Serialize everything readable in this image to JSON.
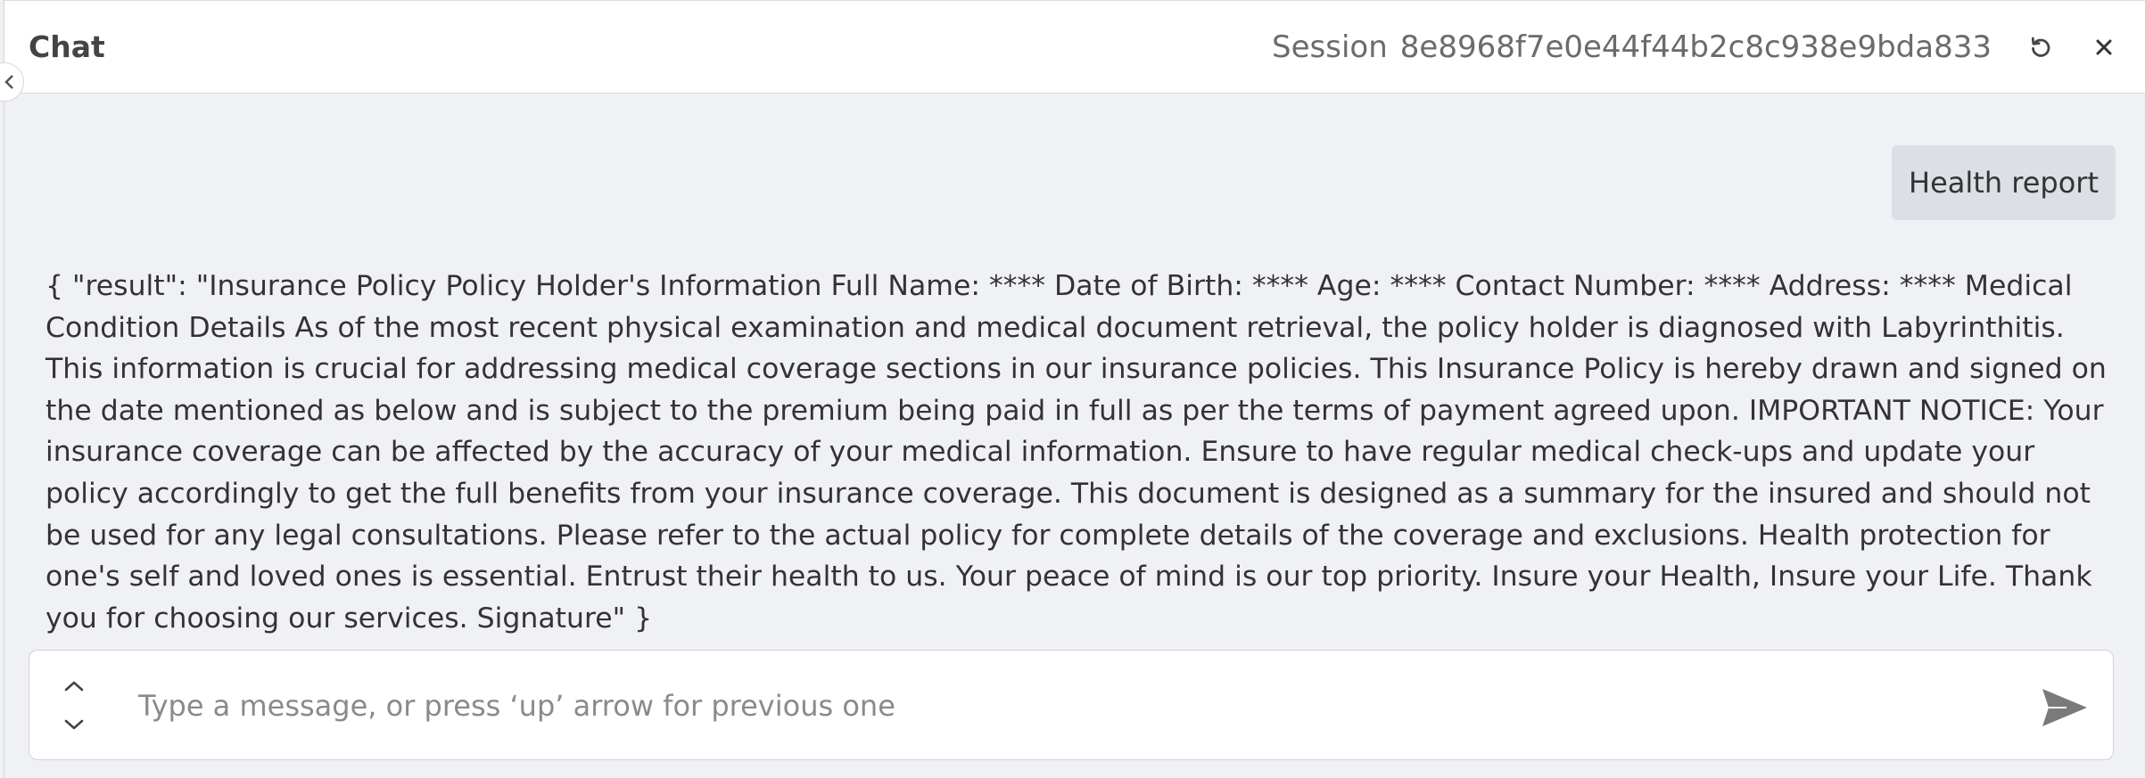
{
  "header": {
    "title": "Chat",
    "session_label": "Session",
    "session_id": "8e8968f7e0e44f44b2c8c938e9bda833"
  },
  "icons": {
    "reset": "reset-icon",
    "close": "close-icon",
    "collapse": "chevron-left-icon",
    "history_up": "chevron-up-icon",
    "history_down": "chevron-down-icon",
    "send": "send-icon"
  },
  "messages": {
    "user": "Health report",
    "assistant": "{ \"result\": \"Insurance Policy Policy Holder's Information Full Name: **** Date of Birth: **** Age: **** Contact Number: **** Address: **** Medical Condition Details As of the most recent physical examination and medical document retrieval, the policy holder is diagnosed with Labyrinthitis. This information is crucial for addressing medical coverage sections in our insurance policies. This Insurance Policy is hereby drawn and signed on the date mentioned as below and is subject to the premium being paid in full as per the terms of payment agreed upon. IMPORTANT NOTICE: Your insurance coverage can be affected by the accuracy of your medical information. Ensure to have regular medical check-ups and update your policy accordingly to get the full benefits from your insurance coverage. This document is designed as a summary for the insured and should not be used for any legal consultations. Please refer to the actual policy for complete details of the coverage and exclusions. Health protection for one's self and loved ones is essential. Entrust their health to us. Your peace of mind is our top priority. Insure your Health, Insure your Life. Thank you for choosing our services. Signature\" }"
  },
  "composer": {
    "value": "",
    "placeholder": "Type a message, or press ‘up’ arrow for previous one"
  },
  "colors": {
    "panel_bg": "#f0f1f4",
    "header_bg": "#ffffff",
    "user_bubble": "#dcdfe6",
    "text": "#333333",
    "muted": "#6b6b6b",
    "send_icon": "#7a7a7a"
  }
}
